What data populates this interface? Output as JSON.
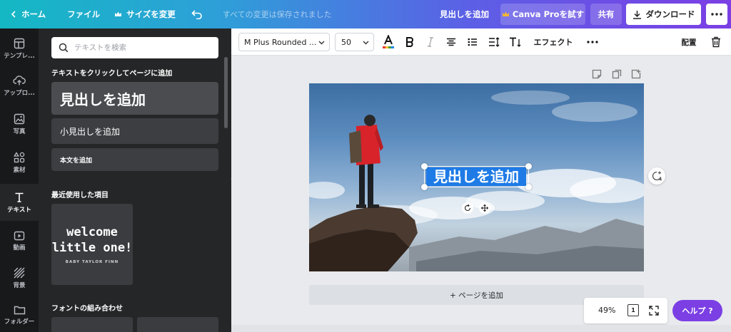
{
  "topbar": {
    "home": "ホーム",
    "file": "ファイル",
    "resize": "サイズを変更",
    "saved_status": "すべての変更は保存されました",
    "add_heading": "見出しを追加",
    "canva_pro": "Canva Proを試す",
    "share": "共有",
    "download": "ダウンロード"
  },
  "rail": {
    "templates": "テンプレ...",
    "uploads": "アップロ...",
    "photos": "写真",
    "elements": "素材",
    "text": "テキスト",
    "video": "動画",
    "background": "背景",
    "folder": "フォルダー"
  },
  "panel": {
    "search_placeholder": "テキストを検索",
    "click_to_add": "テキストをクリックしてページに追加",
    "heading": "見出しを追加",
    "subheading": "小見出しを追加",
    "body": "本文を追加",
    "recent": "最近使用した項目",
    "welcome_line1": "welcome",
    "welcome_line2": "little one!",
    "welcome_sub": "BABY TAYLOR FINN",
    "combos": "フォントの組み合わせ"
  },
  "toolbar": {
    "font_name": "M Plus Rounded ...",
    "font_size": "50",
    "effects": "エフェクト",
    "position": "配置"
  },
  "canvas": {
    "selected_text": "見出しを追加",
    "add_page": "+ ページを追加",
    "zoom": "49%",
    "page_count": "1",
    "help": "ヘルプ ?"
  },
  "colors": {
    "accent_purple": "#7b3fe4",
    "selection_blue": "#1e7be6",
    "panel_dark": "#252627",
    "rail_dark": "#18191b"
  }
}
